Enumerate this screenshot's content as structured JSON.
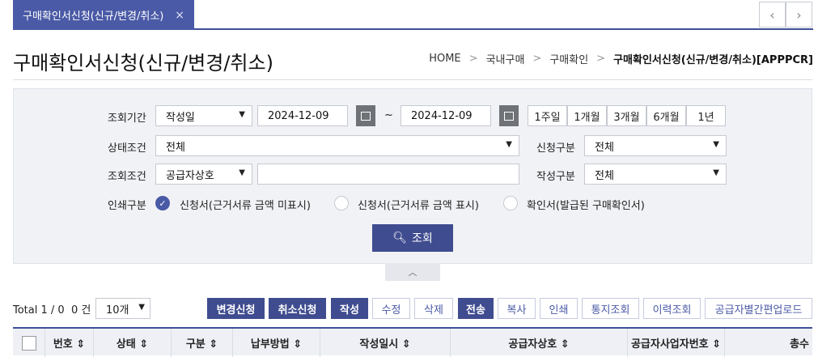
{
  "tab": {
    "label": "구매확인서신청(신규/변경/취소)",
    "close": "×"
  },
  "nav": {
    "prev": "‹",
    "next": "›"
  },
  "page_title": "구매확인서신청(신규/변경/취소)",
  "breadcrumb": {
    "items": [
      "HOME",
      "국내구매",
      "구매확인"
    ],
    "current": "구매확인서신청(신규/변경/취소)[APPPCR]",
    "sep": ">"
  },
  "filters": {
    "period_label": "조회기간",
    "period_type": "작성일",
    "date_from": "2024-12-09",
    "date_sep": "~",
    "date_to": "2024-12-09",
    "quick_periods": [
      "1주일",
      "1개월",
      "3개월",
      "6개월",
      "1년"
    ],
    "status_label": "상태조건",
    "status_value": "전체",
    "apply_type_label": "신청구분",
    "apply_type_value": "전체",
    "search_cond_label": "조회조건",
    "search_cond_value": "공급자상호",
    "search_text": "",
    "write_type_label": "작성구분",
    "write_type_value": "전체",
    "print_label": "인쇄구분",
    "print_options": [
      "신청서(근거서류 금액 미표시)",
      "신청서(근거서류 금액 표시)",
      "확인서(발급된 구매확인서)"
    ],
    "search_button": "조회"
  },
  "list": {
    "total_text": "Total 1 / 0",
    "count_text": "0 건",
    "page_size": "10개",
    "actions": [
      "변경신청",
      "취소신청",
      "작성",
      "수정",
      "삭제",
      "전송",
      "복사",
      "인쇄",
      "통지조회",
      "이력조회",
      "공급자별간편업로드"
    ],
    "columns": [
      "번호 ⇕",
      "상태 ⇕",
      "구분 ⇕",
      "납부방법 ⇕",
      "작성일시 ⇕",
      "공급자상호 ⇕",
      "공급자사업자번호 ⇕",
      "총수"
    ]
  }
}
